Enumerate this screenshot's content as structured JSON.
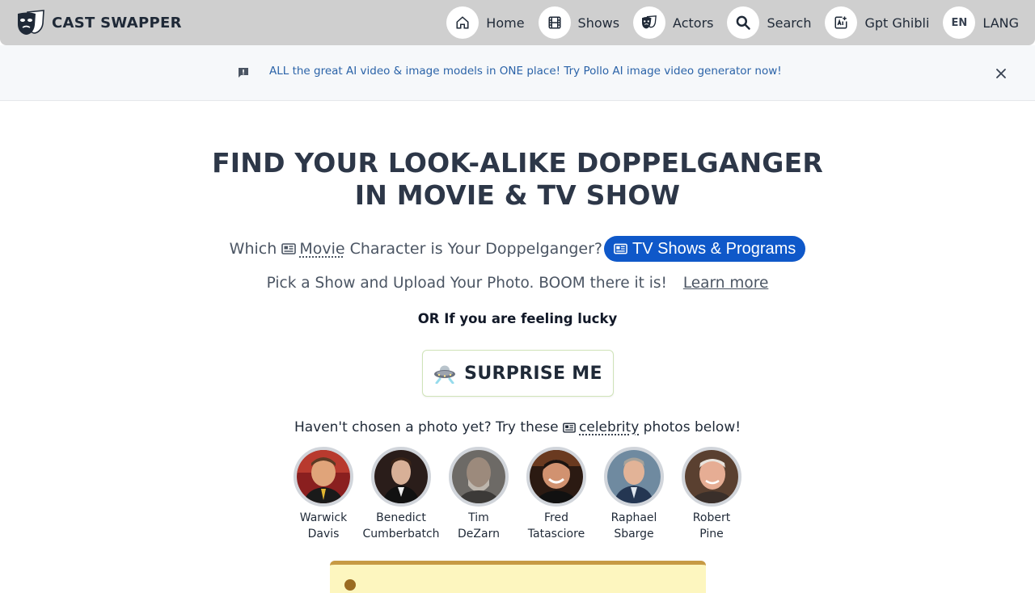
{
  "brand": {
    "name": "CAST SWAPPER"
  },
  "nav": {
    "items": [
      {
        "label": "Home",
        "icon": "home-icon"
      },
      {
        "label": "Shows",
        "icon": "film-icon"
      },
      {
        "label": "Actors",
        "icon": "masks-icon"
      },
      {
        "label": "Search",
        "icon": "search-icon"
      },
      {
        "label": "Gpt Ghibli",
        "icon": "ai-image-icon"
      },
      {
        "label": "LANG",
        "icon": "language-icon",
        "code": "EN"
      }
    ]
  },
  "banner": {
    "text": "ALL the great AI video & image models in ONE place! Try Pollo AI image video generator now!"
  },
  "main": {
    "title_line1": "FIND YOUR LOOK-ALIKE DOPPELGANGER",
    "title_line2": "IN MOVIE & TV SHOW",
    "which_prefix": "Which",
    "movie_word": "Movie",
    "which_suffix": "Character is Your Doppelganger?",
    "pill_label": "TV Shows & Programs",
    "pick_text": "Pick a Show and Upload Your Photo. BOOM there it is!",
    "learn_more": "Learn more",
    "lucky_text": "OR If you are feeling lucky",
    "surprise_label": "SURPRISE ME",
    "haven_prefix": "Haven't chosen a photo yet? Try these",
    "celebrity_word": "celebrity",
    "haven_suffix": "photos below!"
  },
  "celebrities": [
    {
      "first": "Warwick",
      "last": "Davis"
    },
    {
      "first": "Benedict",
      "last": "Cumberbatch"
    },
    {
      "first": "Tim",
      "last": "DeZarn"
    },
    {
      "first": "Fred",
      "last": "Tatasciore"
    },
    {
      "first": "Raphael",
      "last": "Sbarge"
    },
    {
      "first": "Robert",
      "last": "Pine"
    }
  ],
  "colors": {
    "navbar_bg": "#cfcfcf",
    "banner_text": "#2b63a8",
    "pill_bg": "#0f58c9",
    "bottom_card_bg": "#fdf6bf"
  }
}
